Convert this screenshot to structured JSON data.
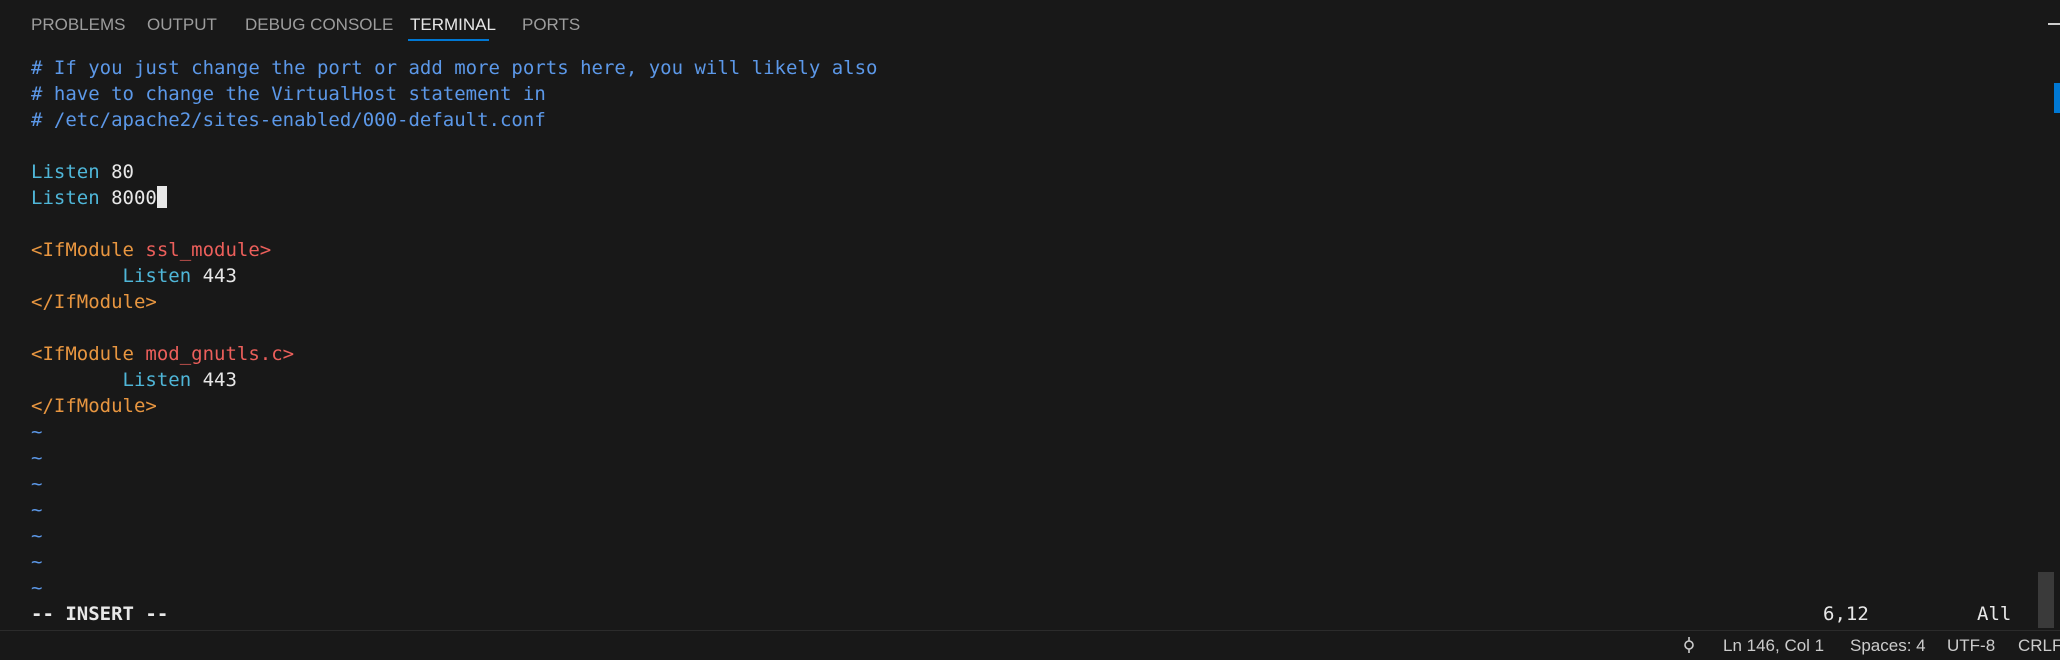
{
  "panel": {
    "tabs": [
      {
        "label": "PROBLEMS",
        "active": false
      },
      {
        "label": "OUTPUT",
        "active": false
      },
      {
        "label": "DEBUG CONSOLE",
        "active": false
      },
      {
        "label": "TERMINAL",
        "active": true
      },
      {
        "label": "PORTS",
        "active": false
      }
    ]
  },
  "terminal": {
    "comments": [
      "# If you just change the port or add more ports here, you will likely also",
      "# have to change the VirtualHost statement in",
      "# /etc/apache2/sites-enabled/000-default.conf"
    ],
    "listen_keyword": "Listen",
    "listen1_port": "80",
    "listen2_port": "8000",
    "block1": {
      "open_tag": "<IfModule",
      "module": "ssl_module>",
      "listen_port": "443",
      "close_tag": "</IfModule>"
    },
    "block2": {
      "open_tag": "<IfModule",
      "module": "mod_gnutls.c>",
      "listen_port": "443",
      "close_tag": "</IfModule>"
    },
    "tilde": "~",
    "vim_mode": "-- INSERT --",
    "vim_position": "6,12",
    "vim_percent": "All"
  },
  "status_bar": {
    "branch_icon": "source-control-icon",
    "cursor_position": "Ln 146, Col 1",
    "spaces": "Spaces: 4",
    "encoding": "UTF-8",
    "eol": "CRLF"
  },
  "colors": {
    "background": "#181818",
    "comment": "#5c98e8",
    "keyword": "#4fb6d8",
    "tag": "#e89640",
    "tag_argument": "#ec5f5b",
    "accent": "#0078d4"
  }
}
